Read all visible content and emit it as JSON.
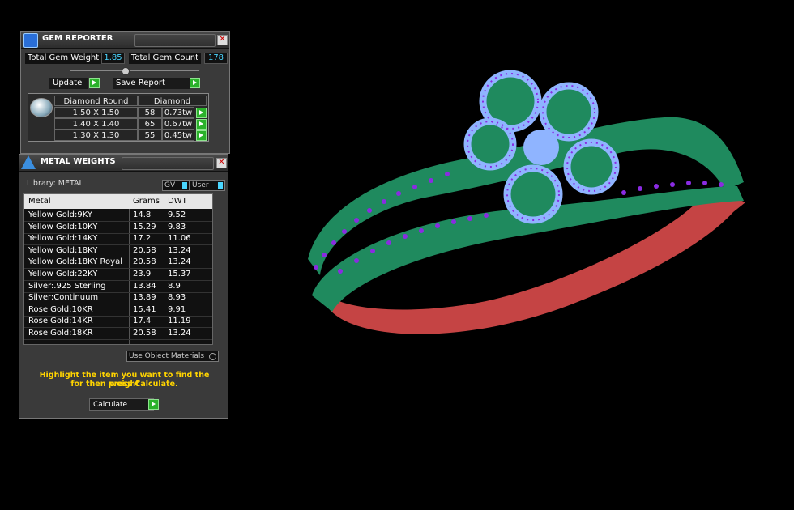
{
  "gem_reporter": {
    "title": "GEM REPORTER",
    "total_weight_label": "Total Gem Weight",
    "total_weight_value": "1.85",
    "total_count_label": "Total Gem Count",
    "total_count_value": "178",
    "update_label": "Update",
    "save_report_label": "Save Report",
    "gem_header": [
      "Diamond Round",
      "Diamond"
    ],
    "gem_rows": [
      {
        "size": "1.50 X 1.50",
        "count": "58",
        "tw": "0.73tw"
      },
      {
        "size": "1.40 X 1.40",
        "count": "65",
        "tw": "0.67tw"
      },
      {
        "size": "1.30 X 1.30",
        "count": "55",
        "tw": "0.45tw"
      }
    ]
  },
  "metal_weights": {
    "title": "METAL WEIGHTS",
    "library_label": "Library: METAL",
    "gv_label": "GV",
    "user_label": "User",
    "columns": [
      "Metal",
      "Grams",
      "DWT"
    ],
    "rows": [
      [
        "Yellow Gold:9KY",
        "14.8",
        "9.52"
      ],
      [
        "Yellow Gold:10KY",
        "15.29",
        "9.83"
      ],
      [
        "Yellow Gold:14KY",
        "17.2",
        "11.06"
      ],
      [
        "Yellow Gold:18KY",
        "20.58",
        "13.24"
      ],
      [
        "Yellow Gold:18KY Royal",
        "20.58",
        "13.24"
      ],
      [
        "Yellow Gold:22KY",
        "23.9",
        "15.37"
      ],
      [
        "Silver:.925 Sterling",
        "13.84",
        "8.9"
      ],
      [
        "Silver:Continuum",
        "13.89",
        "8.93"
      ],
      [
        "Rose Gold:10KR",
        "15.41",
        "9.91"
      ],
      [
        "Rose Gold:14KR",
        "17.4",
        "11.19"
      ],
      [
        "Rose Gold:18KR",
        "20.58",
        "13.24"
      ]
    ],
    "use_object_materials_label": "Use Object Materials",
    "hint_line1": "Highlight the item you want to find the weight",
    "hint_line2": "for then press Calculate.",
    "calculate_label": "Calculate"
  },
  "colors": {
    "metal_green": "#1f8a5e",
    "metal_red": "#d04848",
    "gem_blue": "#8fb4ff",
    "prong_purple": "#8a2be2",
    "value_cyan": "#4ad6ff",
    "hint_yellow": "#ffd400"
  }
}
